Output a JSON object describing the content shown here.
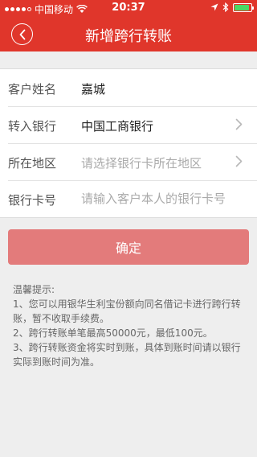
{
  "status_bar": {
    "carrier": "中国移动",
    "time": "20:37",
    "battery_percent": 90
  },
  "nav": {
    "title": "新增跨行转账"
  },
  "form": {
    "rows": [
      {
        "label": "客户姓名",
        "value": ""
      },
      {
        "label": "转入银行",
        "value": "中国工商银行"
      },
      {
        "label": "所在地区",
        "placeholder": "请选择银行卡所在地区"
      },
      {
        "label": "银行卡号",
        "placeholder": "请输入客户本人的银行卡号"
      }
    ],
    "name_value": "嘉城"
  },
  "confirm": {
    "label": "确定"
  },
  "tips": {
    "title": "温馨提示:",
    "items": [
      "1、您可以用银华生利宝份额向同名借记卡进行跨行转账，暂不收取手续费。",
      "2、跨行转账单笔最高50000元，最低100元。",
      "3、跨行转账资金将实时到账，具体到账时间请以银行实际到账时间为准。"
    ]
  },
  "colors": {
    "brand_red": "#e0362b",
    "button_disabled": "#e37b7b"
  }
}
